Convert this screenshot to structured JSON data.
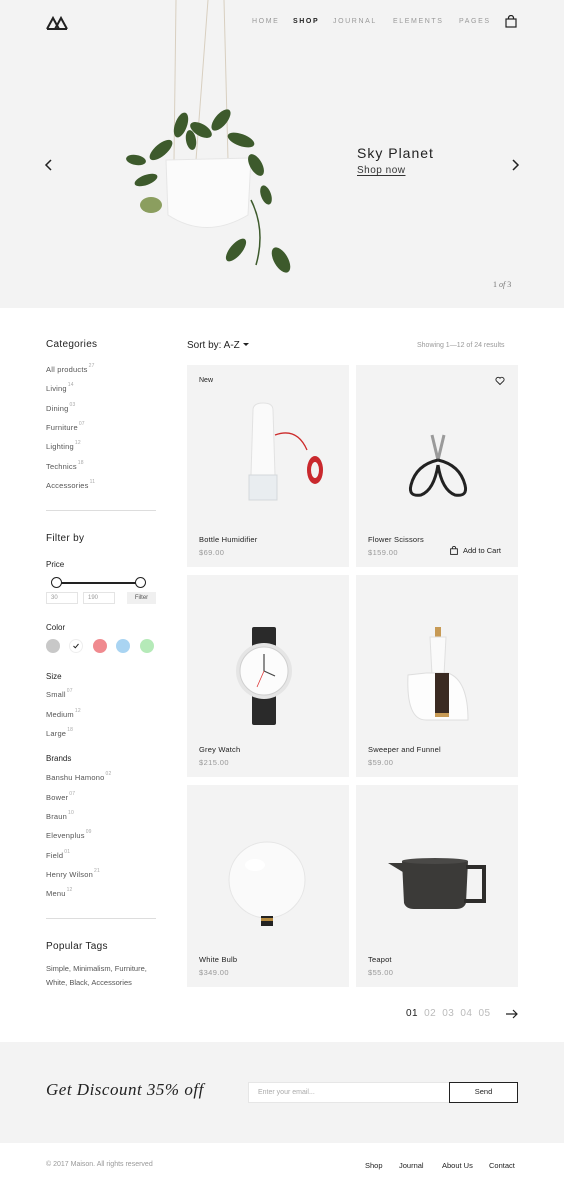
{
  "nav": {
    "items": [
      "HOME",
      "SHOP",
      "JOURNAL",
      "ELEMENTS",
      "PAGES"
    ],
    "active": "SHOP"
  },
  "hero": {
    "title": "Sky Planet",
    "link": "Shop now",
    "pager_current": "1",
    "pager_of": "of",
    "pager_total": "3"
  },
  "sidebar": {
    "categories_title": "Categories",
    "categories": [
      {
        "label": "All products",
        "count": "27"
      },
      {
        "label": "Living",
        "count": "14"
      },
      {
        "label": "Dining",
        "count": "03"
      },
      {
        "label": "Furniture",
        "count": "07"
      },
      {
        "label": "Lighting",
        "count": "12"
      },
      {
        "label": "Technics",
        "count": "18"
      },
      {
        "label": "Accessories",
        "count": "11"
      }
    ],
    "filter_title": "Filter by",
    "price_title": "Price",
    "price_min": "30",
    "price_max": "190",
    "filter_button": "Filter",
    "color_title": "Color",
    "colors": [
      "#c8c8c8",
      "#ffffff",
      "#f08a8f",
      "#a9d4f2",
      "#b5eab8"
    ],
    "selected_color_index": 1,
    "size_title": "Size",
    "sizes": [
      {
        "label": "Small",
        "count": "07"
      },
      {
        "label": "Medium",
        "count": "12"
      },
      {
        "label": "Large",
        "count": "18"
      }
    ],
    "brands_title": "Brands",
    "brands": [
      {
        "label": "Banshu Hamono",
        "count": "02"
      },
      {
        "label": "Bower",
        "count": "07"
      },
      {
        "label": "Braun",
        "count": "10"
      },
      {
        "label": "Elevenplus",
        "count": "09"
      },
      {
        "label": "Field",
        "count": "01"
      },
      {
        "label": "Henry Wilson",
        "count": "21"
      },
      {
        "label": "Menu",
        "count": "12"
      }
    ],
    "tags_title": "Popular Tags",
    "tags_text": "Simple, Minimalism, Furniture, White, Black, Accessories"
  },
  "shop": {
    "sort_label": "Sort by: A-Z",
    "showing": "Showing 1—12 of 24 results",
    "products": [
      {
        "name": "Bottle Humidifier",
        "price": "$69.00",
        "badge": "New"
      },
      {
        "name": "Flower Scissors",
        "price": "$159.00",
        "add_to_cart": "Add to Cart"
      },
      {
        "name": "Grey Watch",
        "price": "$215.00"
      },
      {
        "name": "Sweeper and Funnel",
        "price": "$59.00"
      },
      {
        "name": "White Bulb",
        "price": "$349.00"
      },
      {
        "name": "Teapot",
        "price": "$55.00"
      }
    ],
    "pages": [
      "01",
      "02",
      "03",
      "04",
      "05"
    ],
    "current_page": "01"
  },
  "discount": {
    "title": "Get Discount 35% off",
    "email_placeholder": "Enter your email...",
    "send": "Send"
  },
  "footer": {
    "copyright": "© 2017 Maison. All rights reserved",
    "links": [
      "Shop",
      "Journal",
      "About Us",
      "Contact"
    ]
  },
  "icons": [
    "logo-icon",
    "cart-icon",
    "chevron-left-icon",
    "chevron-right-icon",
    "heart-icon",
    "bag-icon",
    "arrow-right-icon",
    "check-icon"
  ]
}
